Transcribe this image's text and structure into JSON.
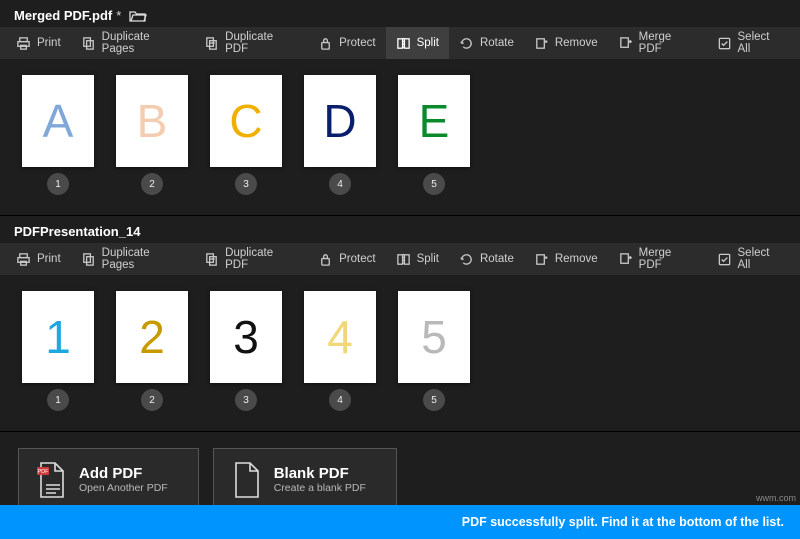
{
  "docs": [
    {
      "title": "Merged PDF.pdf",
      "modified": true,
      "show_folder": true,
      "toolbar_active": "split",
      "pages": [
        {
          "glyph": "A",
          "color": "#7fa8d9",
          "num": "1"
        },
        {
          "glyph": "B",
          "color": "#f4cdb0",
          "num": "2"
        },
        {
          "glyph": "C",
          "color": "#f0b000",
          "num": "3"
        },
        {
          "glyph": "D",
          "color": "#0a1e6e",
          "num": "4"
        },
        {
          "glyph": "E",
          "color": "#0a8a2a",
          "num": "5"
        }
      ]
    },
    {
      "title": "PDFPresentation_14",
      "modified": false,
      "show_folder": false,
      "toolbar_active": null,
      "pages": [
        {
          "glyph": "1",
          "color": "#1fa8e0",
          "num": "1"
        },
        {
          "glyph": "2",
          "color": "#c79a00",
          "num": "2"
        },
        {
          "glyph": "3",
          "color": "#111111",
          "num": "3"
        },
        {
          "glyph": "4",
          "color": "#f2d77a",
          "num": "4"
        },
        {
          "glyph": "5",
          "color": "#b9b9b9",
          "num": "5"
        }
      ]
    }
  ],
  "toolbar_items": [
    {
      "id": "print",
      "label": "Print",
      "icon": "print-icon"
    },
    {
      "id": "duplicate-pages",
      "label": "Duplicate Pages",
      "icon": "duplicate-page-icon"
    },
    {
      "id": "duplicate-pdf",
      "label": "Duplicate PDF",
      "icon": "duplicate-pdf-icon"
    },
    {
      "id": "protect",
      "label": "Protect",
      "icon": "lock-icon"
    },
    {
      "id": "split",
      "label": "Split",
      "icon": "split-icon"
    },
    {
      "id": "rotate",
      "label": "Rotate",
      "icon": "rotate-icon"
    },
    {
      "id": "remove",
      "label": "Remove",
      "icon": "remove-icon"
    },
    {
      "id": "merge",
      "label": "Merge PDF",
      "icon": "merge-icon"
    },
    {
      "id": "select-all",
      "label": "Select All",
      "icon": "checkbox-icon"
    }
  ],
  "add_pdf": {
    "title": "Add PDF",
    "sub": "Open Another PDF"
  },
  "blank_pdf": {
    "title": "Blank PDF",
    "sub": "Create a blank PDF"
  },
  "status_message": "PDF successfully split. Find it at the bottom of the list.",
  "watermark": "wwm.com"
}
